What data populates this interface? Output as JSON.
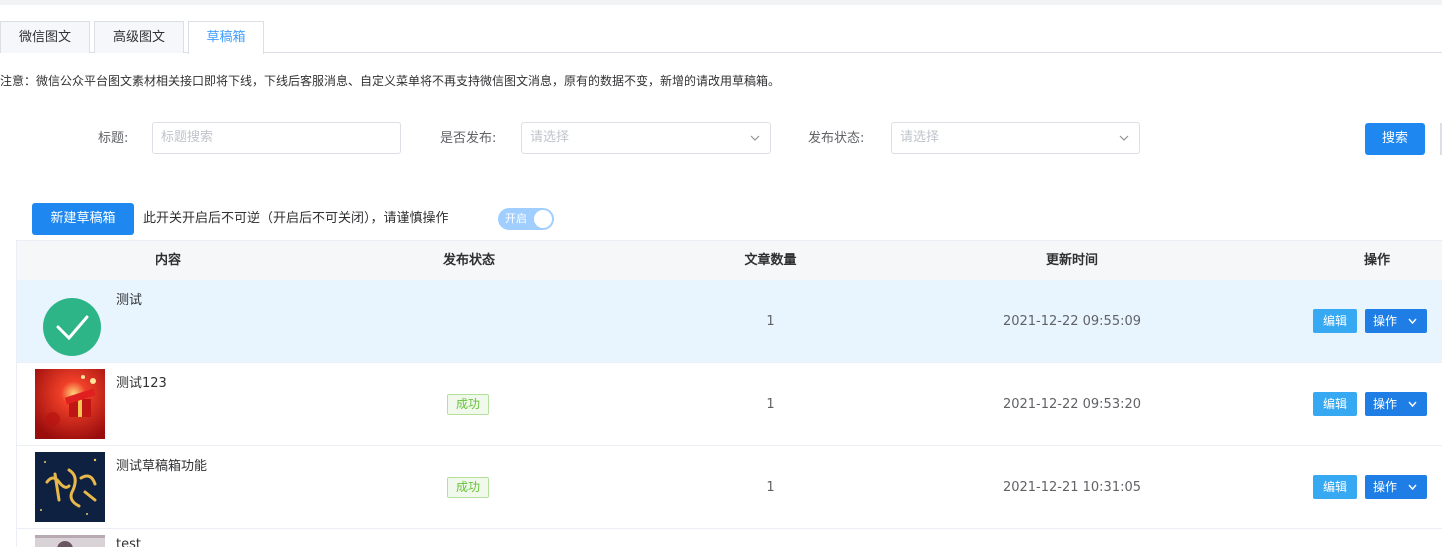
{
  "tabs": [
    {
      "label": "微信图文"
    },
    {
      "label": "高级图文"
    },
    {
      "label": "草稿箱"
    }
  ],
  "notice": "注意：微信公众平台图文素材相关接口即将下线，下线后客服消息、自定义菜单将不再支持微信图文消息，原有的数据不变，新增的请改用草稿箱。",
  "filters": {
    "title_label": "标题:",
    "title_placeholder": "标题搜索",
    "published_label": "是否发布:",
    "published_placeholder": "请选择",
    "status_label": "发布状态:",
    "status_placeholder": "请选择",
    "search_button": "搜索"
  },
  "toolbar": {
    "new_button": "新建草稿箱",
    "switch_note": "此开关开启后不可逆（开启后不可关闭），请谨慎操作",
    "switch_label": "开启",
    "switch_on": true
  },
  "table": {
    "headers": [
      "内容",
      "发布状态",
      "文章数量",
      "更新时间",
      "操作"
    ],
    "rows": [
      {
        "title": "测试",
        "thumb": "green-check-icon",
        "status": "",
        "count": "1",
        "updated": "2021-12-22 09:55:09",
        "edit": "编辑",
        "op": "操作"
      },
      {
        "title": "测试123",
        "thumb": "red-gift-image",
        "status": "成功",
        "count": "1",
        "updated": "2021-12-22 09:53:20",
        "edit": "编辑",
        "op": "操作"
      },
      {
        "title": "测试草稿箱功能",
        "thumb": "gold-calligraphy-image",
        "status": "成功",
        "count": "1",
        "updated": "2021-12-21 10:31:05",
        "edit": "编辑",
        "op": "操作"
      },
      {
        "title": "test",
        "thumb": "cartoon-image"
      }
    ]
  },
  "colors": {
    "primary": "#1e88f0",
    "active_tab": "#409eff",
    "success": "#67c23a",
    "highlight_row": "#e8f4fe"
  }
}
